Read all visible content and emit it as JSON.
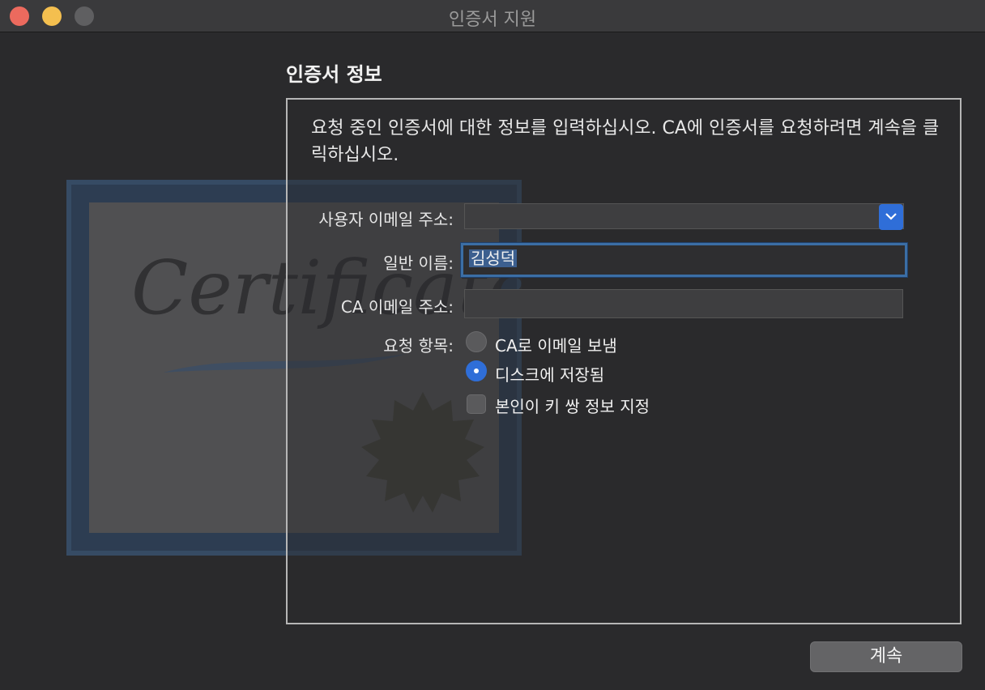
{
  "window": {
    "title": "인증서 지원"
  },
  "section_title": "인증서 정보",
  "intro_text": "요청 중인 인증서에 대한 정보를 입력하십시오. CA에 인증서를 요청하려면 계속을 클릭하십시오.",
  "illustration": {
    "text": "Certificate"
  },
  "form": {
    "user_email_label": "사용자 이메일 주소:",
    "user_email_value": "",
    "common_name_label": "일반 이름:",
    "common_name_value": "김성덕",
    "ca_email_label": "CA 이메일 주소:",
    "ca_email_value": "",
    "request_label": "요청 항목:",
    "options": [
      {
        "label": "CA로 이메일 보냄",
        "selected": false
      },
      {
        "label": "디스크에 저장됨",
        "selected": true
      }
    ],
    "key_pair_label": "본인이 키 쌍 정보 지정",
    "key_pair_checked": false
  },
  "continue_button": "계속",
  "colors": {
    "accent": "#2f6ed8",
    "window_bg": "#2a2a2c"
  }
}
